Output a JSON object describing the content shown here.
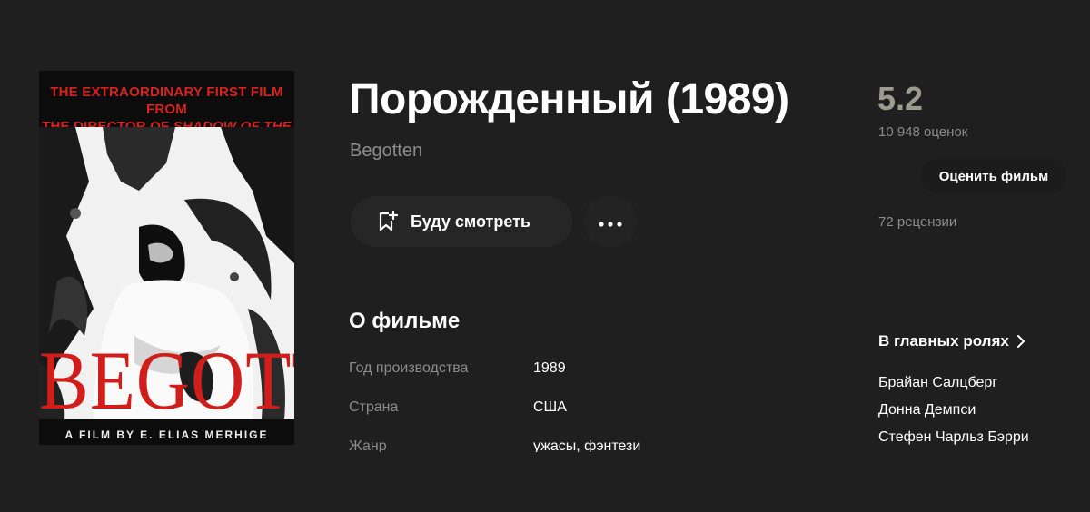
{
  "poster": {
    "tagline_line1": "THE EXTRAORDINARY FIRST FILM FROM",
    "tagline_line2_prefix": "THE DIRECTOR OF ",
    "tagline_line2_italic": "SHADOW OF THE VAMPIRE",
    "poster_title": "BEGOTTEN",
    "credit": "A FILM BY E. ELIAS MERHIGE"
  },
  "film": {
    "title": "Порожденный (1989)",
    "original_title": "Begotten"
  },
  "actions": {
    "watchlist_label": "Буду смотреть",
    "watchlist_icon": "bookmark-plus-icon",
    "more_icon": "more-dots-icon"
  },
  "about": {
    "heading": "О фильме",
    "facts": [
      {
        "key": "Год производства",
        "value": "1989"
      },
      {
        "key": "Страна",
        "value": "США"
      },
      {
        "key": "Жанр",
        "value": "ужасы, фэнтези"
      }
    ]
  },
  "rating": {
    "value": "5.2",
    "votes": "10 948 оценок",
    "rate_button": "Оценить фильм",
    "reviews": "72 рецензии"
  },
  "cast": {
    "heading": "В главных ролях",
    "actors": [
      "Брайан Салцберг",
      "Донна Демпси",
      "Стефен Чарльз Бэрри"
    ]
  },
  "colors": {
    "background": "#1f1f1f",
    "poster_red": "#d01e1a",
    "rating_color": "#9b9b8e",
    "muted_text": "#8c8c8c"
  }
}
